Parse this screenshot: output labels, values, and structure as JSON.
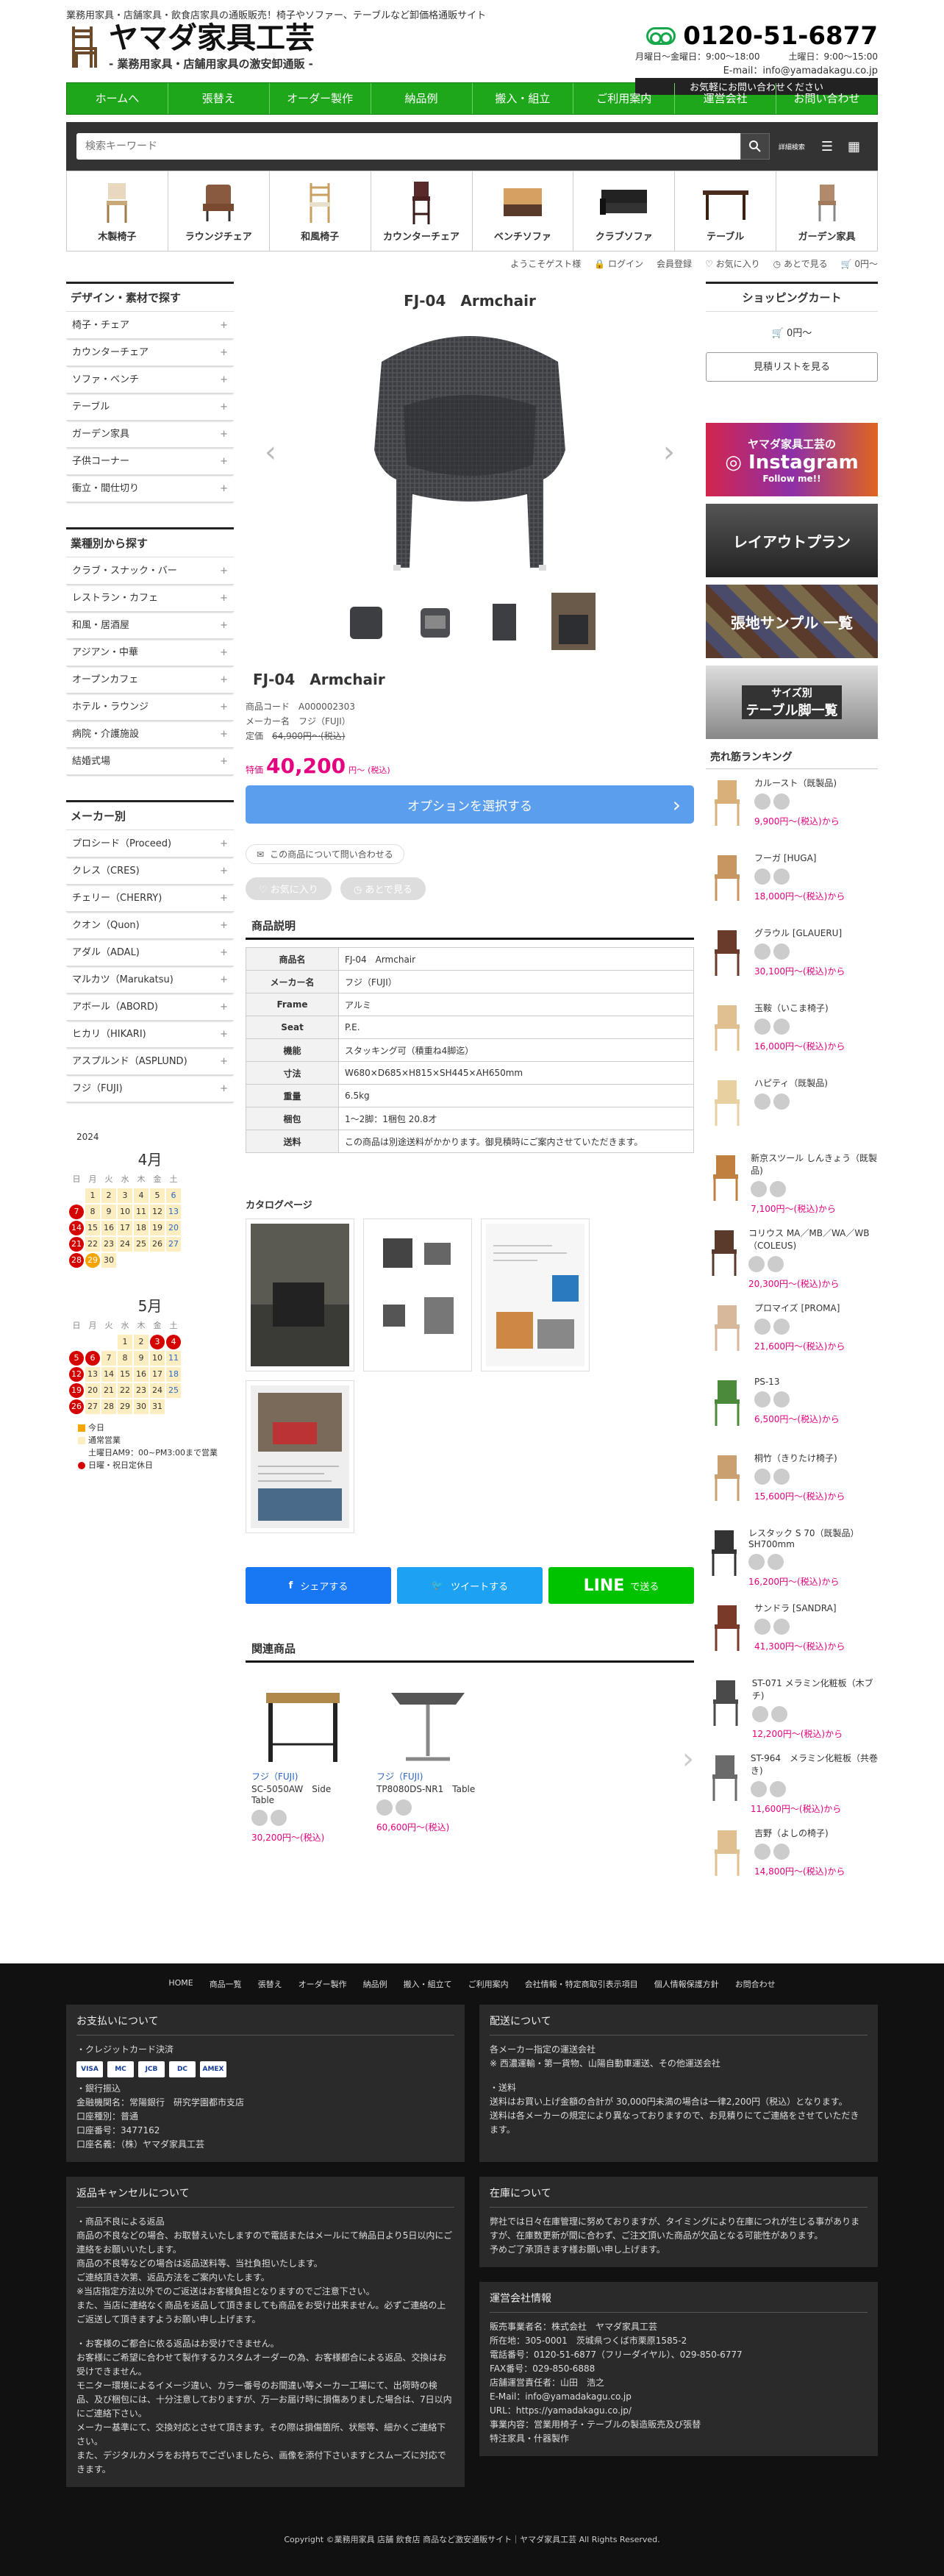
{
  "header": {
    "tagline": "業務用家具・店舗家具・飲食店家具の通販販売！椅子やソファー、テーブルなど卸価格通販サイト",
    "logo_title": "ヤマダ家具工芸",
    "logo_sub": "- 業務用家具・店舗用家具の激安卸通販 -",
    "phone": "0120-51-6877",
    "hours_weekday": "月曜日〜金曜日：9:00〜18:00",
    "hours_sat": "土曜日：9:00〜15:00",
    "email": "E-mail：info@yamadakagu.co.jp",
    "inquiry": "お気軽にお問い合わせください"
  },
  "gnav": [
    "ホームへ",
    "張替え",
    "オーダー製作",
    "納品例",
    "搬入・組立",
    "ご利用案内",
    "運営会社",
    "お問い合わせ"
  ],
  "search": {
    "placeholder": "検索キーワード",
    "detail": "詳細検索"
  },
  "categories": [
    "木製椅子",
    "ラウンジチェア",
    "和風椅子",
    "カウンターチェア",
    "ベンチソファ",
    "クラブソファ",
    "テーブル",
    "ガーデン家具"
  ],
  "util": {
    "welcome": "ようこそゲスト様",
    "login": "ログイン",
    "register": "会員登録",
    "fav": "お気に入り",
    "history": "あとで見る",
    "cart": "0円〜"
  },
  "left": {
    "h1": "デザイン・素材で探す",
    "design": [
      "椅子・チェア",
      "カウンターチェア",
      "ソファ・ベンチ",
      "テーブル",
      "ガーデン家具",
      "子供コーナー",
      "衝立・間仕切り"
    ],
    "h2": "業種別から探す",
    "industry": [
      "クラブ・スナック・バー",
      "レストラン・カフェ",
      "和風・居酒屋",
      "アジアン・中華",
      "オープンカフェ",
      "ホテル・ラウンジ",
      "病院・介護施設",
      "結婚式場"
    ],
    "h3": "メーカー別",
    "maker": [
      "プロシード（Proceed)",
      "クレス（CRES)",
      "チェリー（CHERRY)",
      "クオン（Quon)",
      "アダル（ADAL)",
      "マルカツ（Marukatsu)",
      "アボール（ABORD)",
      "ヒカリ（HIKARI)",
      "アスプルンド（ASPLUND)",
      "フジ（FUJI)"
    ]
  },
  "calendar": {
    "year": "2024",
    "april": "4月",
    "may": "5月",
    "dow": [
      "日",
      "月",
      "火",
      "水",
      "木",
      "金",
      "土"
    ],
    "legend_today": "今日",
    "legend_open": "通常営業",
    "legend_sat": "土曜日AM9：00~PM3:00まで営業",
    "legend_hol": "日曜・祝日定休日"
  },
  "product": {
    "title": "FJ-04　Armchair",
    "code_label": "商品コード",
    "code": "A000002303",
    "maker_label": "メーカー名",
    "maker": "フジ（FUJI）",
    "list_label": "定価",
    "list_price": "64,900円〜(税込)",
    "special": "特価",
    "price": "40,200",
    "price_suffix": "円〜",
    "tax": "(税込)",
    "option_btn": "オプションを選択する",
    "ask": "この商品について問い合わせる",
    "fav": "お気に入り",
    "later": "あとで見る",
    "desc_head": "商品説明",
    "specs": [
      {
        "k": "商品名",
        "v": "FJ-04　Armchair"
      },
      {
        "k": "メーカー名",
        "v": "フジ（FUJI）"
      },
      {
        "k": "Frame",
        "v": "アルミ"
      },
      {
        "k": "Seat",
        "v": "P.E."
      },
      {
        "k": "機能",
        "v": "スタッキング可（積重ね4脚迄）"
      },
      {
        "k": "寸法",
        "v": "W680×D685×H815×SH445×AH650mm"
      },
      {
        "k": "重量",
        "v": "6.5kg"
      },
      {
        "k": "梱包",
        "v": "1〜2脚：1梱包 20.8才"
      },
      {
        "k": "送料",
        "v": "この商品は別途送料がかかります。御見積時にご案内させていただきます。"
      }
    ],
    "catalog": "カタログページ",
    "share_fb": "シェアする",
    "share_tw": "ツイートする",
    "share_line": "LINE",
    "share_line2": "で送る",
    "related": "関連商品",
    "rel": [
      {
        "maker": "フジ（FUJI)",
        "name": "SC-5050AW　Side Table",
        "price": "30,200円〜",
        "tax": "(税込)"
      },
      {
        "maker": "フジ（FUJI)",
        "name": "TP8080DS-NR1　Table",
        "price": "60,600円〜",
        "tax": "(税込)"
      }
    ]
  },
  "right": {
    "cart_head": "ショッピングカート",
    "cart_total": "0円〜",
    "quote_btn": "見積リストを見る",
    "banner1_a": "ヤマダ家具工芸の",
    "banner1_b": "Instagram",
    "banner1_c": "Follow me!!",
    "banner2": "レイアウトプラン",
    "banner3": "張地サンプル 一覧",
    "banner4_a": "サイズ別",
    "banner4_b": "テーブル脚一覧",
    "rank_head": "売れ筋ランキング",
    "ranks": [
      {
        "name": "カルースト（既製品)",
        "price": "9,900円〜(税込)から"
      },
      {
        "name": "フーガ [HUGA]",
        "price": "18,000円〜(税込)から"
      },
      {
        "name": "グラウル [GLAUERU]",
        "price": "30,100円〜(税込)から"
      },
      {
        "name": "玉鞍（いこま椅子)",
        "price": "16,000円〜(税込)から"
      },
      {
        "name": "ハピティ（既製品)",
        "price": ""
      },
      {
        "name": "新京スツール しんきょう（既製品)",
        "price": "7,100円〜(税込)から"
      },
      {
        "name": "コリウス MA／MB／WA／WB（COLEUS)",
        "price": "20,300円〜(税込)から"
      },
      {
        "name": "プロマイズ [PROMA]",
        "price": "21,600円〜(税込)から"
      },
      {
        "name": "PS-13",
        "price": "6,500円〜(税込)から"
      },
      {
        "name": "桐竹（きりたけ椅子)",
        "price": "15,600円〜(税込)から"
      },
      {
        "name": "レスタック S 70（既製品）SH700mm",
        "price": "16,200円〜(税込)から"
      },
      {
        "name": "サンドラ [SANDRA]",
        "price": "41,300円〜(税込)から"
      },
      {
        "name": "ST-071 メラミン化粧板（木ブチ)",
        "price": "12,200円〜(税込)から"
      },
      {
        "name": "ST-964　メラミン化粧板（共巻き)",
        "price": "11,600円〜(税込)から"
      },
      {
        "name": "吉野（よしの椅子)",
        "price": "14,800円〜(税込)から"
      }
    ]
  },
  "footer": {
    "nav": [
      "HOME",
      "商品一覧",
      "張替え",
      "オーダー製作",
      "納品例",
      "搬入・組立て",
      "ご利用案内",
      "会社情報・特定商取引表示項目",
      "個人情報保護方針",
      "お問合わせ"
    ],
    "pay_h": "お支払いについて",
    "pay_card": "・クレジットカード決済",
    "cards": [
      "VISA",
      "MC",
      "JCB",
      "DC",
      "AMEX"
    ],
    "pay_bank": "・銀行振込",
    "bank": [
      "金融機関名：常陽銀行　研究学園都市支店",
      "口座種別：普通",
      "口座番号：3477162",
      "口座名義：（株）ヤマダ家具工芸"
    ],
    "ship_h": "配送について",
    "ship": [
      "各メーカー指定の運送会社",
      "※ 西濃運輸・第一貨物、山陽自動車運送、その他運送会社",
      "",
      "・送料",
      "送料はお買い上げ金額の合計が 30,000円未満の場合は一律2,200円（税込）となります。",
      "送料は各メーカーの規定により異なっておりますので、お見積りにてご連絡をさせていただきます。"
    ],
    "cancel_h": "返品キャンセルについて",
    "cancel": [
      "・商品不良による返品",
      "商品の不良などの場合、お取替えいたしますので電話またはメールにて納品日より5日以内にご連絡をお願いいたします。",
      "商品の不良等などの場合は返品送料等、当社負担いたします。",
      "ご連絡頂き次第、返品方法をご案内いたします。",
      "※当店指定方法以外でのご返送はお客様負担となりますのでご注意下さい。",
      "また、当店に連絡なく商品を返品して頂きましても商品をお受け出来ません。必ずご連絡の上ご返送して頂きますようお願い申し上げます。",
      "",
      "・お客様のご都合に依る返品はお受けできません。",
      "お客様にご希望に合わせて製作するカスタムオーダーの為、お客様都合による返品、交換はお受けできません。",
      "モニター環境によるイメージ違い、カラー番号のお間違い等メーカー工場にて、出荷時の検品、及び梱包には、十分注意しておりますが、万一お届け時に損傷ありました場合は、7日以内にご連絡下さい。",
      "メーカー基準にて、交換対応とさせて頂きます。その際は損傷箇所、状態等、細かくご連絡下さい。",
      "また、デジタルカメラをお持ちでございましたら、画像を添付下さいますとスムーズに対応できます。"
    ],
    "stock_h": "在庫について",
    "stock": [
      "弊社では日々在庫管理に努めておりますが、タイミングにより在庫につれが生じる事がありますが、在庫数更新が間に合わず、ご注文頂いた商品が欠品となる可能性があります。",
      "予めご了承頂きます様お願い申し上げます。"
    ],
    "company_h": "運営会社情報",
    "company": [
      "販売事業者名：株式会社　ヤマダ家具工芸",
      "所在地：305-0001　茨城県つくば市栗原1585-2",
      "電話番号：0120-51-6877（フリーダイヤル）、029-850-6777",
      "FAX番号：029-850-6888",
      "店舗運営責任者：山田　浩之",
      "E-Mail：info@yamadakagu.co.jp",
      "URL：https://yamadakagu.co.jp/",
      "事業内容：営業用椅子・テーブルの製造販売及び張替",
      "特注家具・什器製作"
    ],
    "copyright": "Copyright ©業務用家具 店舗 飲食店 商品など激安通販サイト｜ヤマダ家具工芸 All Rights Reserved."
  }
}
